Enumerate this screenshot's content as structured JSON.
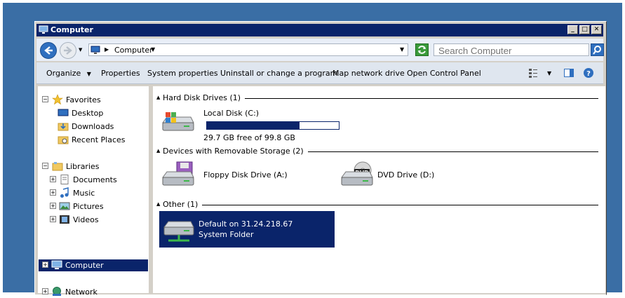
{
  "window": {
    "title": "Computer"
  },
  "address": {
    "crumb": "Computer",
    "search_placeholder": "Search Computer"
  },
  "toolbar": {
    "organize": "Organize",
    "properties": "Properties",
    "system_properties": "System properties",
    "uninstall": "Uninstall or change a program",
    "map_drive": "Map network drive",
    "control_panel": "Open Control Panel"
  },
  "nav": {
    "favorites": "Favorites",
    "desktop": "Desktop",
    "downloads": "Downloads",
    "recent": "Recent Places",
    "libraries": "Libraries",
    "documents": "Documents",
    "music": "Music",
    "pictures": "Pictures",
    "videos": "Videos",
    "computer": "Computer",
    "network": "Network"
  },
  "groups": {
    "hdd": "Hard Disk Drives (1)",
    "removable": "Devices with Removable Storage (2)",
    "other": "Other (1)"
  },
  "drives": {
    "local": {
      "name": "Local Disk (C:)",
      "free": "29.7 GB free of 99.8 GB",
      "used_fraction": 0.7
    },
    "floppy": {
      "name": "Floppy Disk Drive (A:)"
    },
    "dvd": {
      "name": "DVD Drive (D:)",
      "badge": "DVD"
    },
    "network": {
      "name": "Default on 31.24.218.67",
      "type": "System Folder"
    }
  }
}
